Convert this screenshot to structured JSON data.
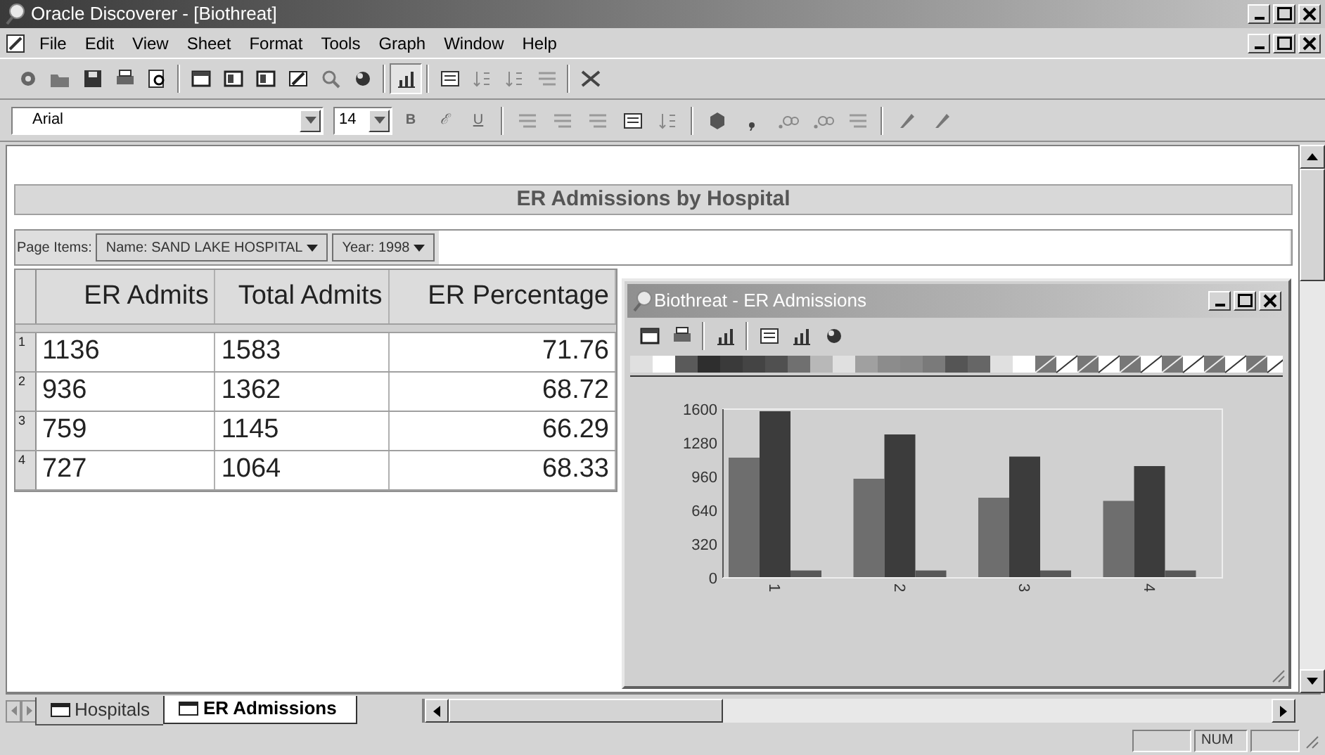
{
  "window": {
    "title": "Oracle Discoverer - [Biothreat]"
  },
  "menu": [
    "File",
    "Edit",
    "View",
    "Sheet",
    "Format",
    "Tools",
    "Graph",
    "Window",
    "Help"
  ],
  "format_toolbar": {
    "font": "Arial",
    "size": "14",
    "style_buttons": [
      "B",
      "ℰ",
      "U"
    ]
  },
  "sheet": {
    "title": "ER Admissions by Hospital",
    "page_items": {
      "label": "Page Items:",
      "items": [
        "Name: SAND LAKE HOSPITAL",
        "Year: 1998"
      ]
    },
    "table": {
      "columns": [
        "ER Admits",
        "Total Admits",
        "ER Percentage"
      ],
      "rows": [
        {
          "number": "1",
          "cells": [
            "1136",
            "1583",
            "71.76"
          ]
        },
        {
          "number": "2",
          "cells": [
            "936",
            "1362",
            "68.72"
          ]
        },
        {
          "number": "3",
          "cells": [
            "759",
            "1145",
            "66.29"
          ]
        },
        {
          "number": "4",
          "cells": [
            "727",
            "1064",
            "68.33"
          ]
        }
      ]
    }
  },
  "graph_window": {
    "title": "Biothreat - ER Admissions",
    "chart_data": {
      "type": "bar",
      "categories": [
        "1",
        "2",
        "3",
        "4"
      ],
      "ylim": [
        0,
        1600
      ],
      "yticks": [
        0,
        320,
        640,
        960,
        1280,
        1600
      ],
      "series": [
        {
          "color": "#6e6e6e",
          "values": [
            1140,
            940,
            760,
            730
          ]
        },
        {
          "color": "#3c3c3c",
          "values": [
            1580,
            1360,
            1150,
            1060
          ]
        },
        {
          "color": "#585858",
          "values": [
            70,
            70,
            70,
            70
          ]
        }
      ]
    }
  },
  "sheet_tabs": [
    {
      "label": "Hospitals",
      "selected": false
    },
    {
      "label": "ER Admissions",
      "selected": true
    }
  ],
  "status_bar": {
    "indicator": "NUM"
  }
}
